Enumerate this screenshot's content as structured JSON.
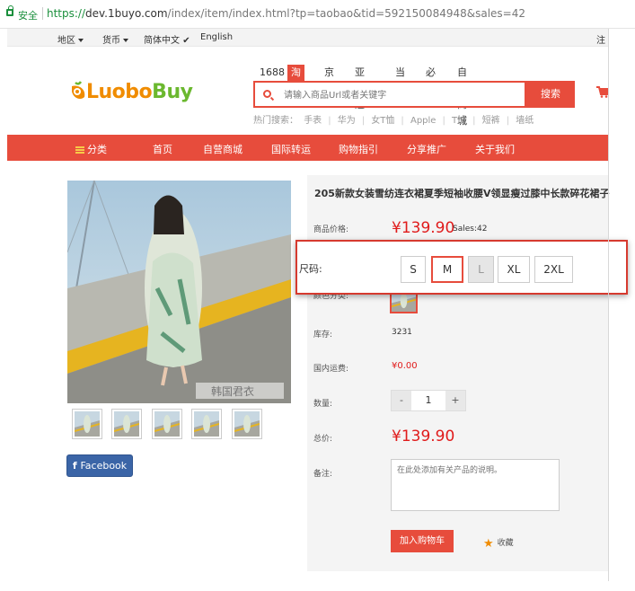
{
  "browser": {
    "secure_label": "安全",
    "url_scheme": "https://",
    "url_host": "dev.1buyo.com",
    "url_rest": "/index/item/index.html?tp=taobao&tid=592150084948&sales=42"
  },
  "topbar": {
    "region": "地区",
    "currency": "货币",
    "simplified": "简体中文",
    "english": "English",
    "right": "注"
  },
  "logo": {
    "part_a": "Luobo",
    "part_b": "Buy"
  },
  "source_tabs": [
    "1688",
    "淘宝",
    "京东",
    "亚马逊",
    "当当",
    "必要",
    "自营商城"
  ],
  "search": {
    "placeholder": "请输入商品Url或者关键字",
    "button": "搜索"
  },
  "hot": {
    "label": "热门搜索：",
    "items": [
      "手表",
      "华为",
      "女T恤",
      "Apple",
      "T恤",
      "短裤",
      "墙纸"
    ]
  },
  "nav": [
    "分类",
    "首页",
    "自营商城",
    "国际转运",
    "购物指引",
    "分享推广",
    "关于我们"
  ],
  "product": {
    "title": "205新款女装雪纺连衣裙夏季短袖收腰V领显瘦过膝中长款碎花裙子",
    "price_label": "商品价格:",
    "price": "¥139.90",
    "sales": "Sales:42",
    "color_label": "颜色分类:",
    "stock_label": "库存:",
    "stock": "3231",
    "ship_label": "国内运费:",
    "ship": "¥0.00",
    "qty_label": "数量:",
    "qty_minus": "-",
    "qty": "1",
    "qty_plus": "+",
    "total_label": "总价:",
    "total": "¥139.90",
    "note_label": "备注:",
    "note_placeholder": "在此处添加有关产品的说明。",
    "add_cart": "加入购物车",
    "favorite": "收藏",
    "watermark": "韩国君衣"
  },
  "facebook": "Facebook",
  "size": {
    "label": "尺码:",
    "options": [
      "S",
      "M",
      "L",
      "XL",
      "2XL"
    ],
    "selected": "M",
    "disabled": "L"
  },
  "colors": {
    "accent": "#e74c3c",
    "price": "#e01b1b",
    "secure": "#1a8f3c",
    "facebook": "#3b65a7"
  }
}
